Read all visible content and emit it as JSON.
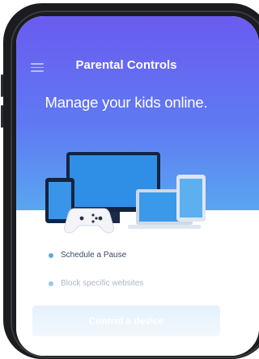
{
  "header": {
    "title": "Parental Controls",
    "menu_icon": "hamburger-menu-icon"
  },
  "hero": {
    "headline": "Manage your kids online."
  },
  "features": [
    {
      "label": "Schedule a Pause",
      "dot_color": "#5aa9ef"
    },
    {
      "label": "Block specific websites",
      "dot_color": "#8fc2f2"
    }
  ],
  "cta": {
    "label": "Control a device"
  },
  "colors": {
    "gradient_top": "#6a5bf0",
    "gradient_bottom": "#59a6f0",
    "accent": "#5aa9ef"
  }
}
